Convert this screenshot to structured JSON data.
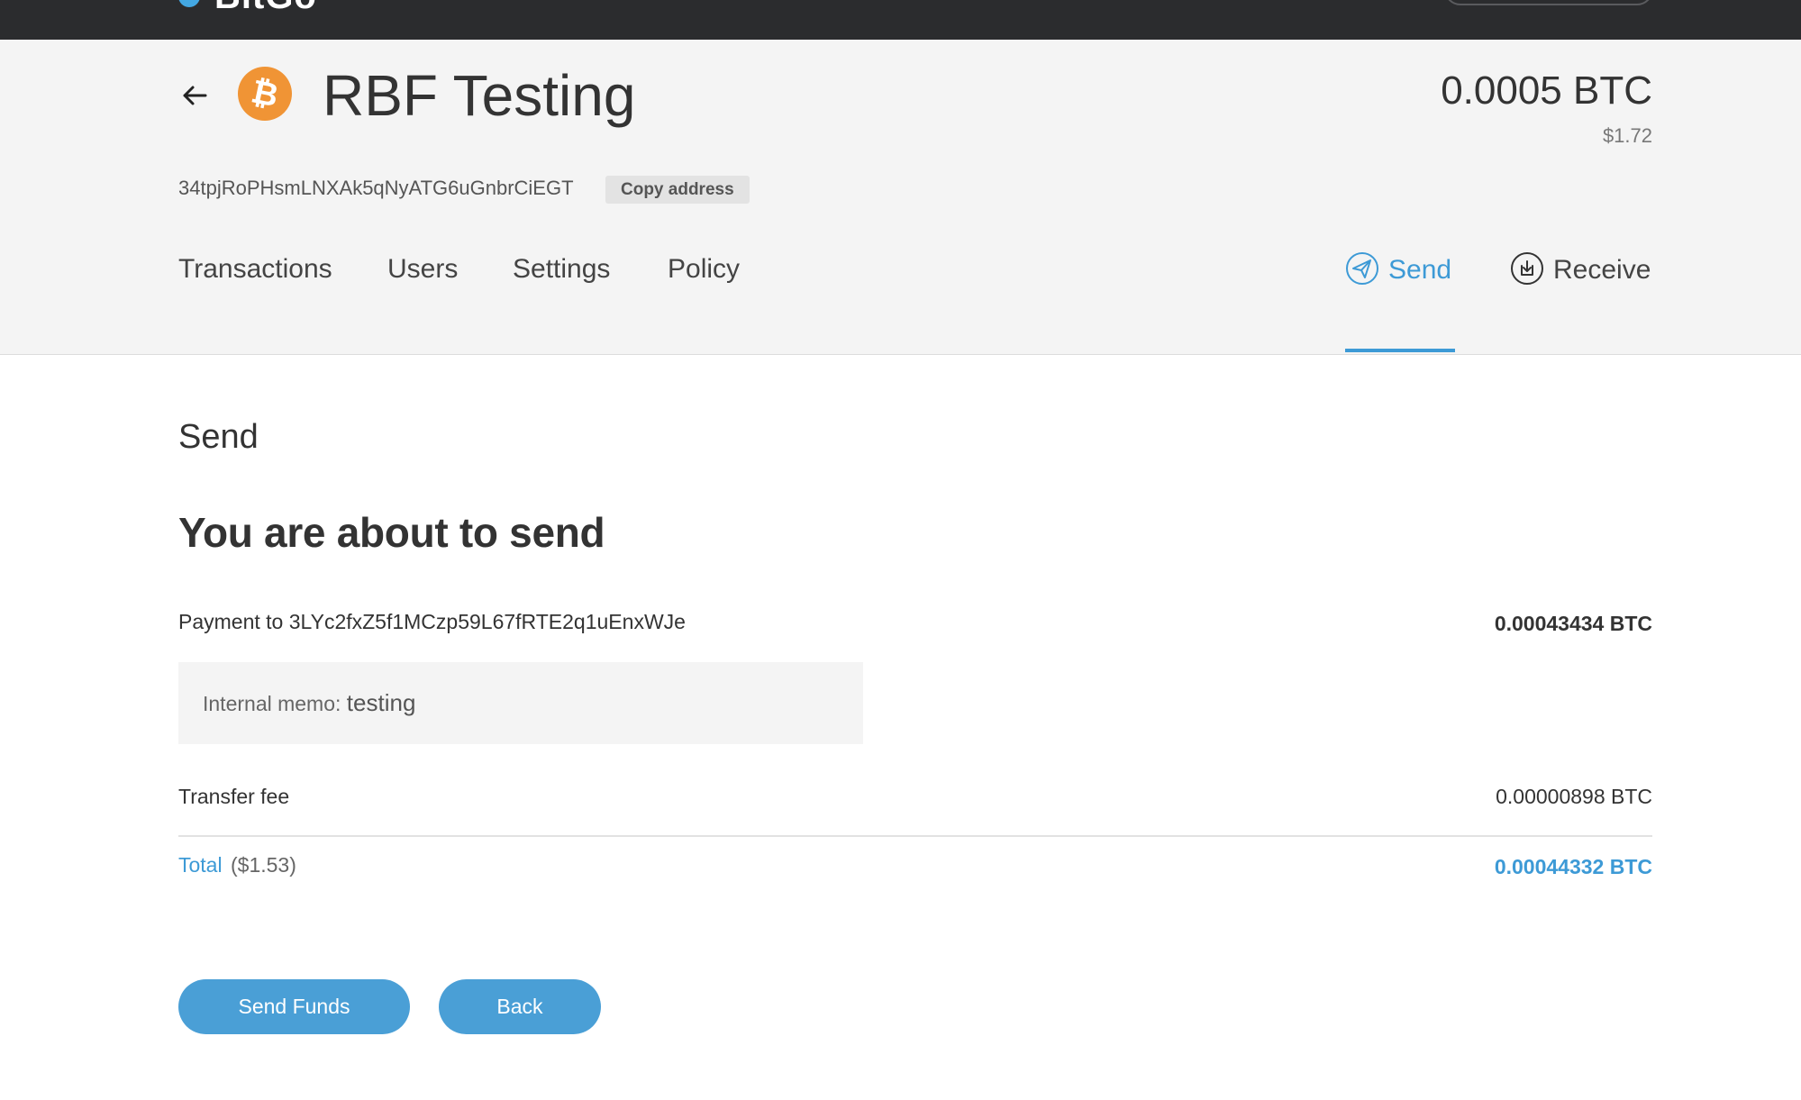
{
  "topbar": {
    "brand": "BitGo"
  },
  "wallet": {
    "name": "RBF Testing",
    "coin_symbol": "₿",
    "balance_btc": "0.0005 BTC",
    "balance_usd": "$1.72",
    "address": "34tpjRoPHsmLNXAk5qNyATG6uGnbrCiEGT",
    "copy_label": "Copy address"
  },
  "tabs": [
    {
      "label": "Transactions"
    },
    {
      "label": "Users"
    },
    {
      "label": "Settings"
    },
    {
      "label": "Policy"
    }
  ],
  "actions": {
    "send_label": "Send",
    "receive_label": "Receive"
  },
  "send": {
    "section_title": "Send",
    "heading": "You are about to send",
    "payment_label": "Payment to 3LYc2fxZ5f1MCzp59L67fRTE2q1uEnxWJe",
    "payment_amount": "0.00043434 BTC",
    "memo_label": "Internal memo: ",
    "memo_value": "testing",
    "fee_label": "Transfer fee",
    "fee_amount": "0.00000898 BTC",
    "total_label": "Total",
    "total_usd": "($1.53)",
    "total_amount": "0.00044332 BTC",
    "send_button": "Send Funds",
    "back_button": "Back"
  },
  "colors": {
    "accent": "#3d9ad6",
    "button": "#4a9fd6",
    "bitcoin": "#f09435",
    "topbar": "#2b2c2e"
  }
}
